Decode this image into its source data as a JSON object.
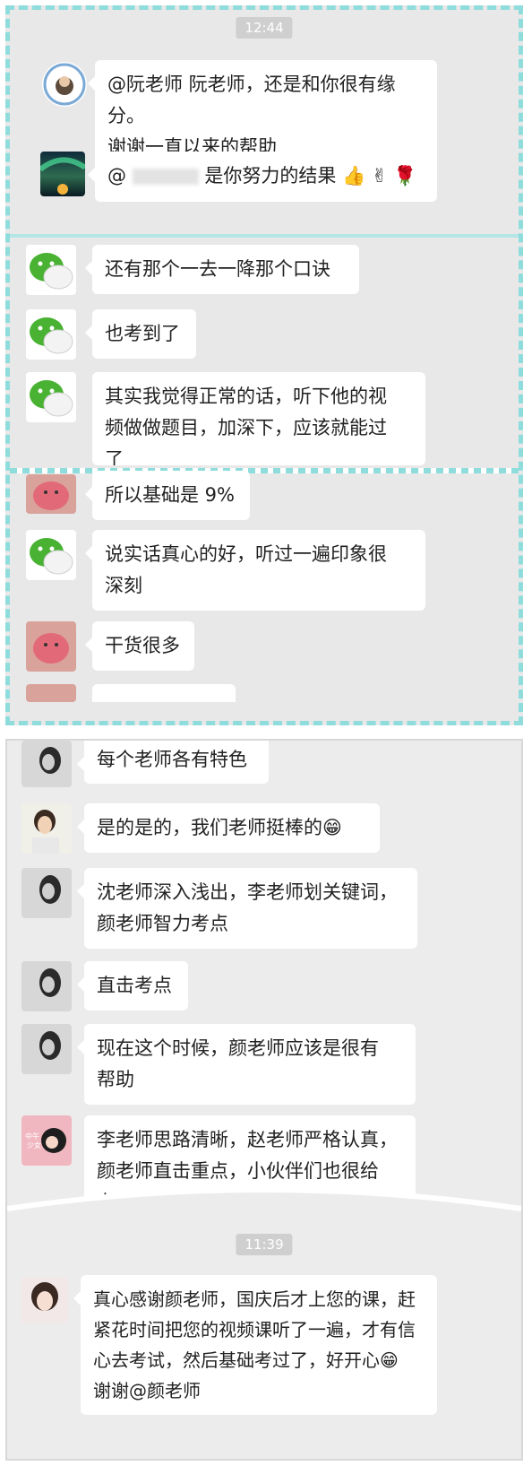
{
  "panel1": {
    "timestamp": "12:44",
    "messages": [
      {
        "id": "m1",
        "avatar": "school-seal",
        "text_lines": [
          "@阮老师 阮老师，还是和你很有缘分。",
          "谢谢一直以来的帮助"
        ]
      },
      {
        "id": "m2",
        "avatar": "aurora",
        "prefix": "@",
        "suffix": "是你努力的结果",
        "emojis": [
          "👍",
          "✌",
          "🌹"
        ]
      },
      {
        "id": "m3",
        "avatar": "wechat",
        "text_lines": [
          "还有那个一去一降那个口诀"
        ]
      },
      {
        "id": "m4",
        "avatar": "wechat",
        "text_lines": [
          "也考到了"
        ]
      },
      {
        "id": "m5",
        "avatar": "wechat",
        "text_lines": [
          "其实我觉得正常的话，听下他的视",
          "频做做题目，加深下，应该就能过",
          "了"
        ]
      },
      {
        "id": "m6",
        "avatar": "pig",
        "text_lines": [
          "所以基础是 9%"
        ]
      },
      {
        "id": "m7",
        "avatar": "wechat",
        "text_lines": [
          "说实话真心的好，听过一遍印象很",
          "深刻"
        ]
      },
      {
        "id": "m8",
        "avatar": "pig",
        "text_lines": [
          "干货很多"
        ]
      }
    ]
  },
  "panel2": {
    "timestamp": "11:39",
    "messages": [
      {
        "id": "n1",
        "avatar": "girl",
        "text_lines": [
          "每个老师各有特色"
        ]
      },
      {
        "id": "n2",
        "avatar": "woman",
        "text_lines": [
          "是的是的，我们老师挺棒的😁"
        ]
      },
      {
        "id": "n3",
        "avatar": "girl",
        "text_lines": [
          "沈老师深入浅出，李老师划关键词，",
          "颜老师智力考点"
        ]
      },
      {
        "id": "n4",
        "avatar": "girl",
        "text_lines": [
          "直击考点"
        ]
      },
      {
        "id": "n5",
        "avatar": "girl",
        "text_lines": [
          "现在这个时候，颜老师应该是很有",
          "帮助"
        ]
      },
      {
        "id": "n6",
        "avatar": "pink",
        "text_lines": [
          "李老师思路清晰，赵老师严格认真，",
          "颜老师直击重点，小伙伴们也很给",
          "力，赞赞赞"
        ]
      },
      {
        "id": "n7",
        "avatar": "girl2",
        "text_lines": [
          "真心感谢颜老师，国庆后才上您的课，赶",
          "紧花时间把您的视频课听了一遍，才有信",
          "心去考试，然后基础考过了，好开心😁",
          "谢谢@颜老师"
        ]
      }
    ]
  }
}
